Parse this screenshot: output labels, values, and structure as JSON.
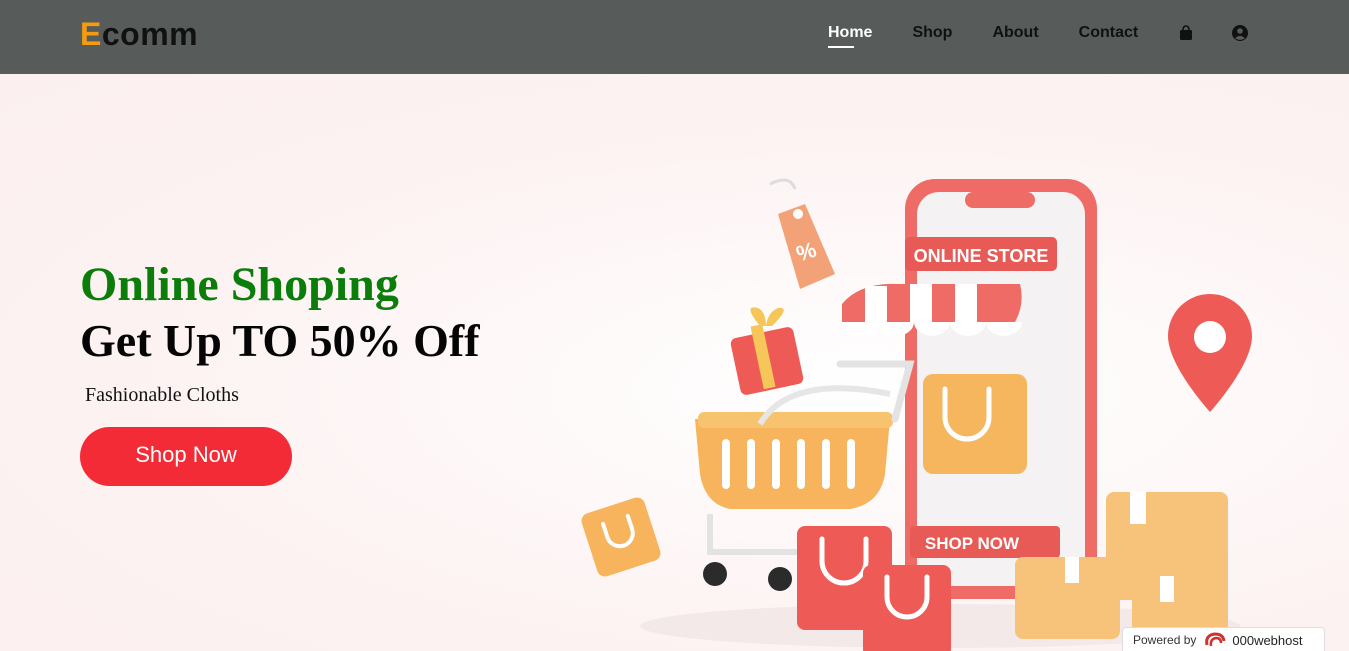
{
  "brand": {
    "first_letter": "E",
    "rest": "comm"
  },
  "nav": {
    "items": [
      {
        "label": "Home",
        "active": true
      },
      {
        "label": "Shop",
        "active": false
      },
      {
        "label": "About",
        "active": false
      },
      {
        "label": "Contact",
        "active": false
      }
    ],
    "icons": [
      "shopping-bag-icon",
      "user-circle-icon"
    ]
  },
  "hero": {
    "headline_1": "Online Shoping",
    "headline_2": "Get Up TO 50% Off",
    "subtitle": "Fashionable Cloths",
    "cta_label": "Shop Now",
    "illustration": {
      "phone_sign": "ONLINE STORE",
      "phone_button": "SHOP NOW",
      "tag_symbol": "%"
    }
  },
  "footer_badge": {
    "powered_by": "Powered by",
    "host": "000webhost"
  },
  "colors": {
    "nav_bg": "#575c5b",
    "logo_accent": "#f39c12",
    "headline_green": "#0a7d0a",
    "cta_red": "#f22b36"
  }
}
